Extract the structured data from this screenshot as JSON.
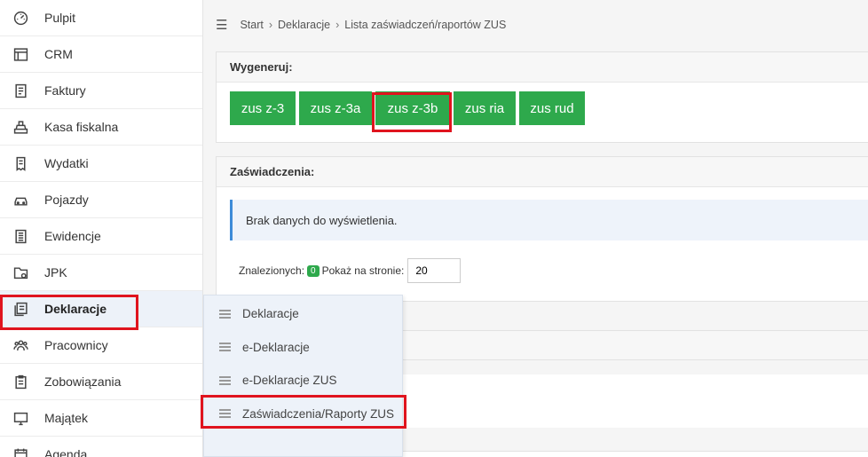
{
  "sidebar": {
    "items": [
      {
        "label": "Pulpit",
        "icon": "dashboard-icon"
      },
      {
        "label": "CRM",
        "icon": "layout-icon"
      },
      {
        "label": "Faktury",
        "icon": "invoice-icon"
      },
      {
        "label": "Kasa fiskalna",
        "icon": "cash-register-icon"
      },
      {
        "label": "Wydatki",
        "icon": "receipt-icon"
      },
      {
        "label": "Pojazdy",
        "icon": "car-icon"
      },
      {
        "label": "Ewidencje",
        "icon": "ledger-icon"
      },
      {
        "label": "JPK",
        "icon": "folder-icon"
      },
      {
        "label": "Deklaracje",
        "icon": "declaration-icon"
      },
      {
        "label": "Pracownicy",
        "icon": "employees-icon"
      },
      {
        "label": "Zobowiązania",
        "icon": "clipboard-icon"
      },
      {
        "label": "Majątek",
        "icon": "monitor-icon"
      },
      {
        "label": "Agenda",
        "icon": "calendar-icon"
      }
    ]
  },
  "breadcrumb": {
    "items": [
      "Start",
      "Deklaracje",
      "Lista zaświadczeń/raportów ZUS"
    ]
  },
  "generate": {
    "title": "Wygeneruj:",
    "buttons": [
      "zus z-3",
      "zus z-3a",
      "zus z-3b",
      "zus ria",
      "zus rud"
    ],
    "button_color": "#2ea94c"
  },
  "certificates": {
    "title": "Zaświadczenia:",
    "empty_message": "Brak danych do wyświetlenia.",
    "found_label": "Znalezionych:",
    "found_count": "0",
    "per_page_label": "Pokaż na stronie:",
    "per_page_value": "20"
  },
  "dropdown": {
    "items": [
      "Deklaracje",
      "e-Deklaracje",
      "e-Deklaracje ZUS",
      "Zaświadczenia/Raporty ZUS"
    ]
  },
  "colors": {
    "highlight": "#e0141e",
    "accent_blue": "#3d8bd8"
  }
}
